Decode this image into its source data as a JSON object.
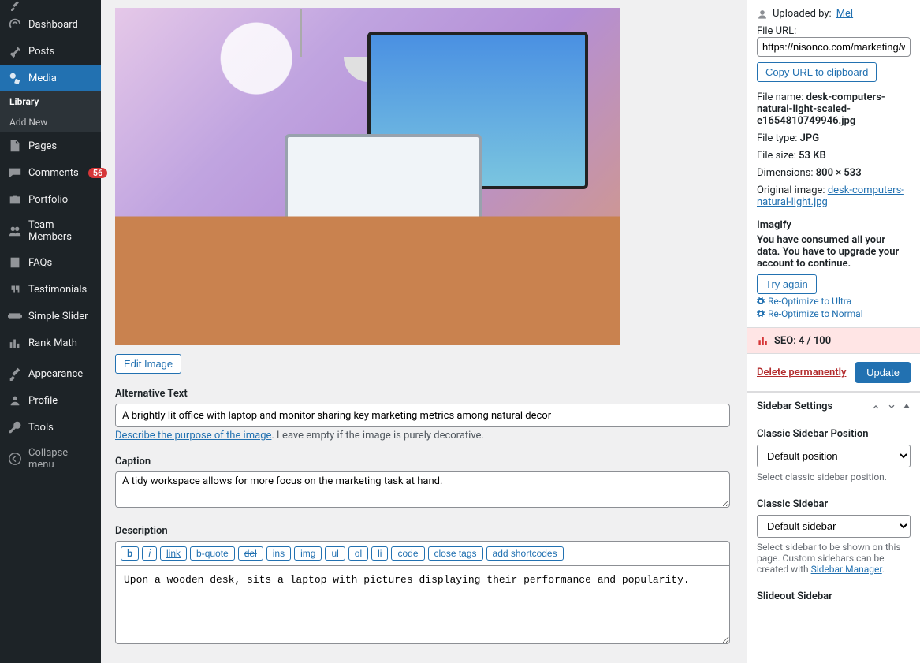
{
  "sidebar": {
    "items": [
      {
        "label": "Dashboard"
      },
      {
        "label": "Posts"
      },
      {
        "label": "Media"
      },
      {
        "label": "Pages"
      },
      {
        "label": "Comments",
        "badge": "56"
      },
      {
        "label": "Portfolio"
      },
      {
        "label": "Team Members"
      },
      {
        "label": "FAQs"
      },
      {
        "label": "Testimonials"
      },
      {
        "label": "Simple Slider"
      },
      {
        "label": "Rank Math"
      },
      {
        "label": "Appearance"
      },
      {
        "label": "Profile"
      },
      {
        "label": "Tools"
      }
    ],
    "media_sub": {
      "library": "Library",
      "addnew": "Add New"
    },
    "collapse": "Collapse menu"
  },
  "main": {
    "edit_image": "Edit Image",
    "alt_label": "Alternative Text",
    "alt_value": "A brightly lit office with laptop and monitor sharing key marketing metrics among natural decor",
    "alt_link": "Describe the purpose of the image",
    "alt_help_suffix": ". Leave empty if the image is purely decorative.",
    "caption_label": "Caption",
    "caption_value": "A tidy workspace allows for more focus on the marketing task at hand.",
    "desc_label": "Description",
    "desc_value": "Upon a wooden desk, sits a laptop with pictures displaying their performance and popularity.",
    "qtags": [
      "b",
      "i",
      "link",
      "b-quote",
      "del",
      "ins",
      "img",
      "ul",
      "ol",
      "li",
      "code",
      "close tags",
      "add shortcodes"
    ]
  },
  "right": {
    "uploaded_by_label": "Uploaded by:",
    "uploaded_by_value": "Mel",
    "file_url_label": "File URL:",
    "file_url_value": "https://nisonco.com/marketing/wp-co",
    "copy_url": "Copy URL to clipboard",
    "file_name_label": "File name:",
    "file_name_value": "desk-computers-natural-light-scaled-e1654810749946.jpg",
    "file_type_label": "File type:",
    "file_type_value": "JPG",
    "file_size_label": "File size:",
    "file_size_value": "53 KB",
    "dimensions_label": "Dimensions:",
    "dimensions_value": "800 × 533",
    "original_label": "Original image:",
    "original_value": "desk-computers-natural-light.jpg",
    "imagify_title": "Imagify",
    "imagify_msg": "You have consumed all your data. You have to upgrade your account to continue.",
    "try_again": "Try again",
    "reopt_ultra": "Re-Optimize to Ultra",
    "reopt_normal": "Re-Optimize to Normal",
    "seo": "SEO: 4 / 100",
    "delete": "Delete permanently",
    "update": "Update",
    "sidebar_settings": "Sidebar Settings",
    "classic_pos_label": "Classic Sidebar Position",
    "classic_pos_value": "Default position",
    "classic_pos_help": "Select classic sidebar position.",
    "classic_sb_label": "Classic Sidebar",
    "classic_sb_value": "Default sidebar",
    "classic_sb_help_1": "Select sidebar to be shown on this page. Custom sidebars can be created with ",
    "classic_sb_help_link": "Sidebar Manager",
    "slideout_label": "Slideout Sidebar"
  }
}
